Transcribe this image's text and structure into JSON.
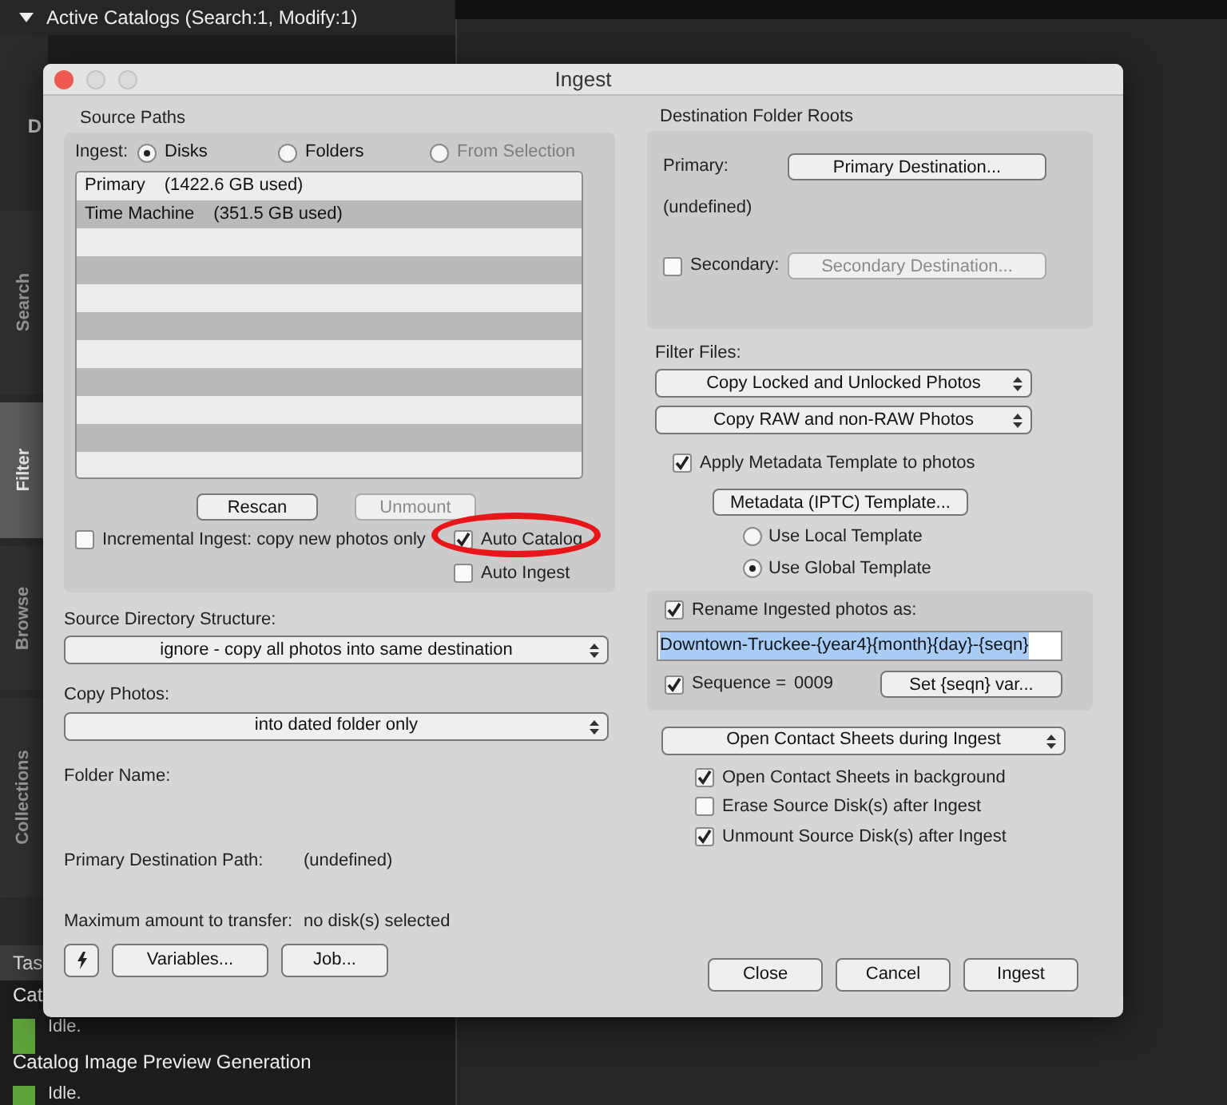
{
  "background": {
    "header": "Active Catalogs (Search:1, Modify:1)",
    "partial_label": "D",
    "side_tabs": [
      {
        "label": "Search",
        "selected": false
      },
      {
        "label": "Filter",
        "selected": true
      },
      {
        "label": "Browse",
        "selected": false
      },
      {
        "label": "Collections",
        "selected": false
      }
    ],
    "tasks_header": "Tas",
    "tasks": [
      {
        "name": "Cat",
        "status": "Idle."
      },
      {
        "name": "Catalog Image Preview Generation",
        "status": "Idle."
      }
    ]
  },
  "dialog": {
    "title": "Ingest",
    "source_paths": {
      "title": "Source Paths",
      "ingest_label": "Ingest:",
      "modes": [
        {
          "label": "Disks",
          "selected": true,
          "disabled": false
        },
        {
          "label": "Folders",
          "selected": false,
          "disabled": false
        },
        {
          "label": "From Selection",
          "selected": false,
          "disabled": true
        }
      ],
      "disks": [
        {
          "name": "Primary",
          "used": "(1422.6 GB used)"
        },
        {
          "name": "Time Machine",
          "used": "(351.5 GB used)"
        }
      ],
      "buttons": [
        {
          "label": "Rescan",
          "disabled": false
        },
        {
          "label": "Unmount",
          "disabled": true
        }
      ],
      "incremental": {
        "label": "Incremental Ingest: copy new photos only",
        "checked": false
      },
      "auto_catalog": {
        "label": "Auto Catalog",
        "checked": true,
        "highlighted": true
      },
      "auto_ingest": {
        "label": "Auto Ingest",
        "checked": false
      }
    },
    "source_directory_structure": {
      "label": "Source Directory Structure:",
      "value": "ignore - copy all photos into same destination"
    },
    "copy_photos": {
      "label": "Copy Photos:",
      "value": "into dated folder only"
    },
    "folder_name": {
      "label": "Folder Name:"
    },
    "primary_destination_path": {
      "label": "Primary Destination Path:",
      "value": "(undefined)"
    },
    "max_transfer": {
      "label": "Maximum amount to transfer:",
      "value": "no disk(s) selected"
    },
    "left_buttons": [
      "Variables...",
      "Job..."
    ],
    "destination": {
      "title": "Destination Folder Roots",
      "primary_label": "Primary:",
      "primary_button": "Primary Destination...",
      "primary_value": "(undefined)",
      "secondary": {
        "label": "Secondary:",
        "checked": false,
        "button": "Secondary Destination..."
      }
    },
    "filter": {
      "label": "Filter Files:",
      "selects": [
        "Copy Locked and Unlocked Photos",
        "Copy RAW and non-RAW Photos"
      ]
    },
    "metadata": {
      "label": "Apply Metadata Template to photos",
      "checked": true,
      "button": "Metadata (IPTC) Template...",
      "templates": [
        {
          "label": "Use Local Template",
          "selected": false
        },
        {
          "label": "Use Global Template",
          "selected": true
        }
      ]
    },
    "rename": {
      "label": "Rename Ingested photos as:",
      "checked": true,
      "value": "Downtown-Truckee-{year4}{month}{day}-{seqn}",
      "sequence": {
        "label": "Sequence =",
        "value": "0009",
        "checked": true
      },
      "button": "Set {seqn} var..."
    },
    "contact_sheets": {
      "value": "Open Contact Sheets during Ingest",
      "options": [
        {
          "label": "Open Contact Sheets in background",
          "checked": true
        },
        {
          "label": "Erase Source Disk(s) after Ingest",
          "checked": false
        },
        {
          "label": "Unmount Source Disk(s) after Ingest",
          "checked": true
        }
      ]
    },
    "footer_buttons": [
      "Close",
      "Cancel",
      "Ingest"
    ]
  }
}
